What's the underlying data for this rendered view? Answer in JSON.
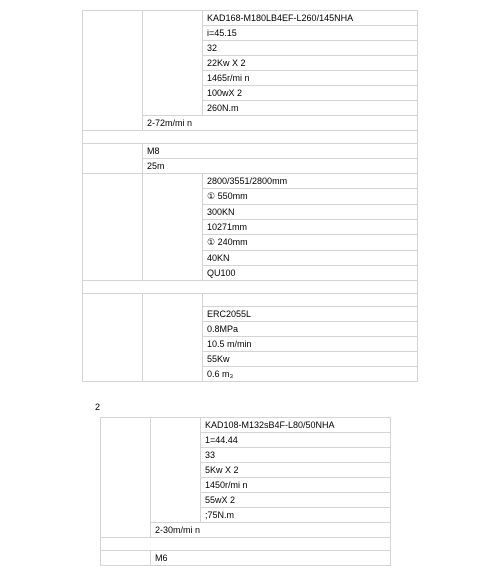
{
  "section1": {
    "rows": [
      {
        "a": "",
        "b": "",
        "c": "KAD168-M180LB4EF-L260/145NHA"
      },
      {
        "a": "",
        "b": "",
        "c": "i=45.15"
      },
      {
        "a": "",
        "b": "",
        "c": "32"
      },
      {
        "a": "",
        "b": "",
        "c": "22Kw X 2"
      },
      {
        "a": "",
        "b": "",
        "c": "1465r/mi n"
      },
      {
        "a": "",
        "b": "",
        "c": "100wX 2"
      },
      {
        "a": "",
        "b": "",
        "c": "260N.m"
      },
      {
        "a": "",
        "b": "2-72m/mi n",
        "c": ""
      },
      {
        "a": "",
        "b": "",
        "c": ""
      },
      {
        "a": "",
        "b": "M8",
        "c": ""
      },
      {
        "a": "",
        "b": "25m",
        "c": ""
      },
      {
        "a": "",
        "b": "",
        "c": "2800/3551/2800mm"
      },
      {
        "a": "",
        "b": "",
        "c": "① 550mm"
      },
      {
        "a": "",
        "b": "",
        "c": "300KN"
      },
      {
        "a": "",
        "b": "",
        "c": "10271mm"
      },
      {
        "a": "",
        "b": "",
        "c": "① 240mm"
      },
      {
        "a": "",
        "b": "",
        "c": "40KN"
      },
      {
        "a": "",
        "b": "",
        "c": "QU100"
      },
      {
        "a": "",
        "b": "",
        "c": ""
      },
      {
        "a": "",
        "b": "",
        "c": ""
      },
      {
        "a": "",
        "b": "",
        "c": "ERC2055L"
      },
      {
        "a": "",
        "b": "",
        "c": "0.8MPa"
      },
      {
        "a": "",
        "b": "",
        "c": "10.5 m/min"
      },
      {
        "a": "",
        "b": "",
        "c": "55Kw"
      },
      {
        "a": "",
        "b": "",
        "c": "0.6 m₃"
      }
    ]
  },
  "section2_label": "2",
  "section2": {
    "rows": [
      {
        "a": "",
        "b": "",
        "c": "KAD108-M132sB4F-L80/50NHA"
      },
      {
        "a": "",
        "b": "",
        "c": "1=44.44"
      },
      {
        "a": "",
        "b": "",
        "c": "33"
      },
      {
        "a": "",
        "b": "",
        "c": "5Kw X 2"
      },
      {
        "a": "",
        "b": "",
        "c": "1450r/mi n"
      },
      {
        "a": "",
        "b": "",
        "c": "55wX 2"
      },
      {
        "a": "",
        "b": "",
        "c": ";75N.m"
      },
      {
        "a": "",
        "b": "2-30m/mi n",
        "c": ""
      },
      {
        "a": "",
        "b": "",
        "c": ""
      },
      {
        "a": "",
        "b": "M6",
        "c": ""
      }
    ]
  }
}
